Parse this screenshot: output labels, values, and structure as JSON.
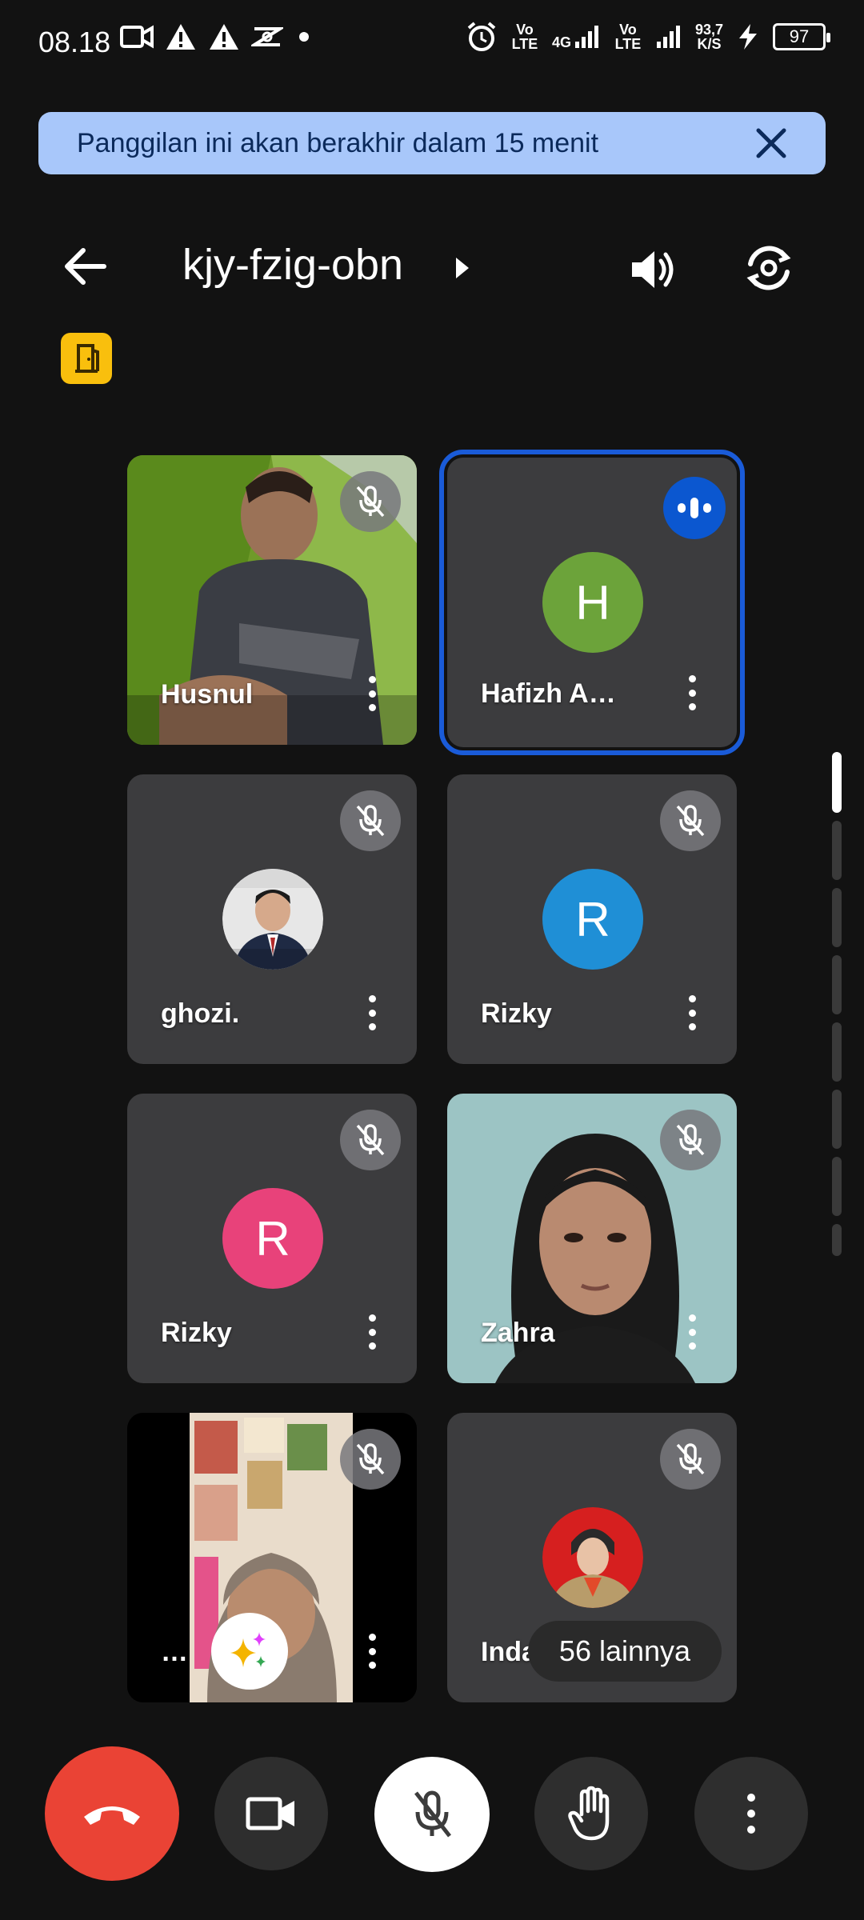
{
  "status_bar": {
    "time": "08.18",
    "net_speed_value": "93,7",
    "net_speed_unit": "K/S",
    "volte_label": "Vo LTE",
    "network_label": "4G",
    "battery": "97"
  },
  "banner": {
    "text": "Panggilan ini akan berakhir dalam 15 menit"
  },
  "header": {
    "meeting_code": "kjy-fzig-obn"
  },
  "participants": [
    {
      "name": "Husnul",
      "state": "muted",
      "type": "video"
    },
    {
      "name": "Hafizh A…",
      "state": "speaking",
      "type": "avatar",
      "initial": "H",
      "color": "#6ca33a"
    },
    {
      "name": "ghozi.",
      "state": "muted",
      "type": "photo-avatar"
    },
    {
      "name": "Rizky",
      "state": "muted",
      "type": "avatar",
      "initial": "R",
      "color": "#1f8fd6"
    },
    {
      "name": "Rizky",
      "state": "muted",
      "type": "avatar",
      "initial": "R",
      "color": "#e8427a"
    },
    {
      "name": "Zahra",
      "state": "muted",
      "type": "video"
    },
    {
      "name": "…",
      "state": "muted",
      "type": "video"
    },
    {
      "name": "Indah",
      "state": "muted",
      "type": "photo-avatar"
    }
  ],
  "more_chip": "56 lainnya",
  "controls": {
    "end_call": "end-call",
    "camera": "camera",
    "mic": "mic-off",
    "raise_hand": "raise-hand",
    "more": "more-options"
  },
  "colors": {
    "banner_bg": "#a8c7fa",
    "active_outline": "#1a5bd8",
    "end_call": "#ea4335",
    "door_badge": "#f9bf0d"
  }
}
